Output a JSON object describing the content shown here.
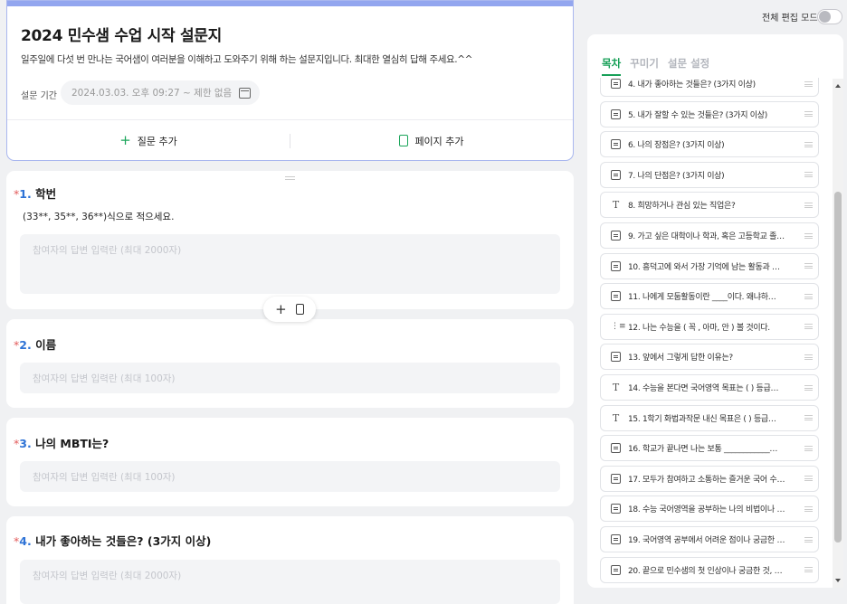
{
  "survey": {
    "title": "2024 민수샘 수업 시작 설문지",
    "description": "일주일에 다섯 번 만나는 국어샘이 여러분을 이해하고 도와주기 위해 하는 설문지입니다. 최대한 열심히 답해 주세요.^^",
    "period_label": "설문 기간",
    "period_value": "2024.03.03. 오후 09:27 ~ 제한 없음",
    "add_question_label": "질문 추가",
    "add_page_label": "페이지 추가"
  },
  "questions": [
    {
      "required_mark": "*",
      "number": "1.",
      "title": "학번",
      "subtitle": "(33**, 35**, 36**)식으로 적으세요.",
      "placeholder": "참여자의 답변 입력란 (최대 2000자)"
    },
    {
      "required_mark": "*",
      "number": "2.",
      "title": "이름",
      "placeholder": "참여자의 답변 입력란 (최대 100자)"
    },
    {
      "required_mark": "*",
      "number": "3.",
      "title": "나의 MBTI는?",
      "placeholder": "참여자의 답변 입력란 (최대 100자)"
    },
    {
      "required_mark": "*",
      "number": "4.",
      "title": "내가 좋아하는 것들은? (3가지 이상)",
      "placeholder": "참여자의 답변 입력란 (최대 2000자)"
    }
  ],
  "edit_mode_label": "전체 편집 모드",
  "panel": {
    "tabs": [
      "목차",
      "꾸미기",
      "설문 설정"
    ],
    "active_tab": "목차",
    "toc": [
      {
        "icon": "doc",
        "label": "4. 내가 좋아하는 것들은? (3가지 이상)"
      },
      {
        "icon": "doc",
        "label": "5. 내가 잘할 수 있는 것들은? (3가지 이상)"
      },
      {
        "icon": "doc",
        "label": "6. 나의 장점은? (3가지 이상)"
      },
      {
        "icon": "doc",
        "label": "7. 나의 단점은? (3가지 이상)"
      },
      {
        "icon": "txt",
        "label": "8. 희망하거나 관심 있는 직업은?"
      },
      {
        "icon": "doc",
        "label": "9. 가고 싶은 대학이나 학과, 혹은 고등학교 졸…"
      },
      {
        "icon": "doc",
        "label": "10. 흥덕고에 와서 가장 기억에 남는 활동과 …"
      },
      {
        "icon": "doc",
        "label": "11. 나에게 모둠활동이란 ____이다.    왜냐하…"
      },
      {
        "icon": "list",
        "label": "12. 나는 수능을 ( 꼭 , 아마, 안 ) 볼 것이다."
      },
      {
        "icon": "doc",
        "label": "13. 앞에서 그렇게 답한 이유는?"
      },
      {
        "icon": "txt",
        "label": "14. 수능을 본다면 국어영역 목표는 (   ) 등급…"
      },
      {
        "icon": "txt",
        "label": "15. 1학기 화법과작문 내신 목표은 (   ) 등급…"
      },
      {
        "icon": "doc",
        "label": "16. 학교가 끝나면 나는 보통 ____________…"
      },
      {
        "icon": "doc",
        "label": "17. 모두가 참여하고 소통하는 즐거운 국어 수…"
      },
      {
        "icon": "doc",
        "label": "18. 수능 국어영역을 공부하는 나의 비법이나 …"
      },
      {
        "icon": "doc",
        "label": "19. 국어영역 공부에서 어려운 점이나 궁금한 …"
      },
      {
        "icon": "doc",
        "label": "20. 끝으로 민수샘의 첫 인상이나 궁금한 것, …"
      }
    ]
  },
  "colors": {
    "accent": "#18a058",
    "header_border": "#a9b7ef",
    "required": "#e25b5b",
    "number": "#2f73d6"
  }
}
